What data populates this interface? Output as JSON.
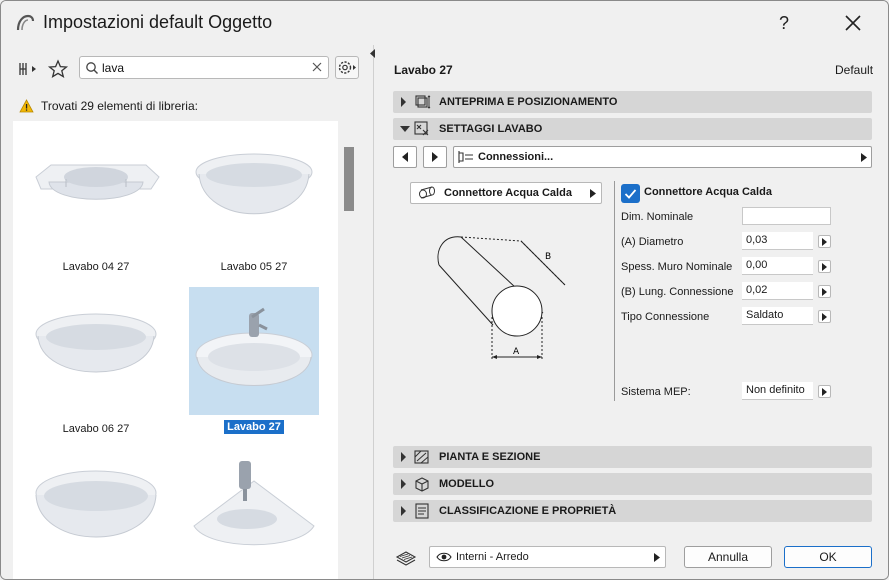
{
  "window": {
    "title": "Impostazioni default Oggetto"
  },
  "search": {
    "value": "lava",
    "placeholder": ""
  },
  "library": {
    "found_text": "Trovati 29 elementi di libreria:",
    "items": [
      {
        "label": "Lavabo 04 27",
        "selected": false
      },
      {
        "label": "Lavabo 05 27",
        "selected": false
      },
      {
        "label": "Lavabo 06 27",
        "selected": false
      },
      {
        "label": "Lavabo 27",
        "selected": true
      },
      {
        "label": "",
        "selected": false
      },
      {
        "label": "",
        "selected": false
      }
    ]
  },
  "object": {
    "name": "Lavabo 27",
    "default_label": "Default"
  },
  "sections": {
    "preview": "ANTEPRIMA E POSIZIONAMENTO",
    "settings": "SETTAGGI LAVABO",
    "plan": "PIANTA E SEZIONE",
    "model": "MODELLO",
    "classification": "CLASSIFICAZIONE E PROPRIETÀ"
  },
  "nav": {
    "page": "Connessioni..."
  },
  "connector": {
    "dropdown_label": "Connettore Acqua Calda",
    "checkbox_label": "Connettore Acqua Calda",
    "checked": true,
    "diagram_label_a": "A",
    "diagram_label_b": "B"
  },
  "params": [
    {
      "label": "Dim. Nominale",
      "value": "",
      "has_button": false
    },
    {
      "label": "(A) Diametro",
      "value": "0,03",
      "has_button": true
    },
    {
      "label": "Spess. Muro Nominale",
      "value": "0,00",
      "has_button": true
    },
    {
      "label": "(B) Lung. Connessione",
      "value": "0,02",
      "has_button": true
    },
    {
      "label": "Tipo Connessione",
      "value": "Saldato",
      "has_button": true
    }
  ],
  "mep": {
    "label": "Sistema MEP:",
    "value": "Non definito"
  },
  "footer": {
    "layer": "Interni - Arredo",
    "cancel": "Annulla",
    "ok": "OK"
  },
  "colors": {
    "accent": "#1b6fc9",
    "selection_bg": "#c7def0",
    "section_bg": "#d6d6d6"
  }
}
